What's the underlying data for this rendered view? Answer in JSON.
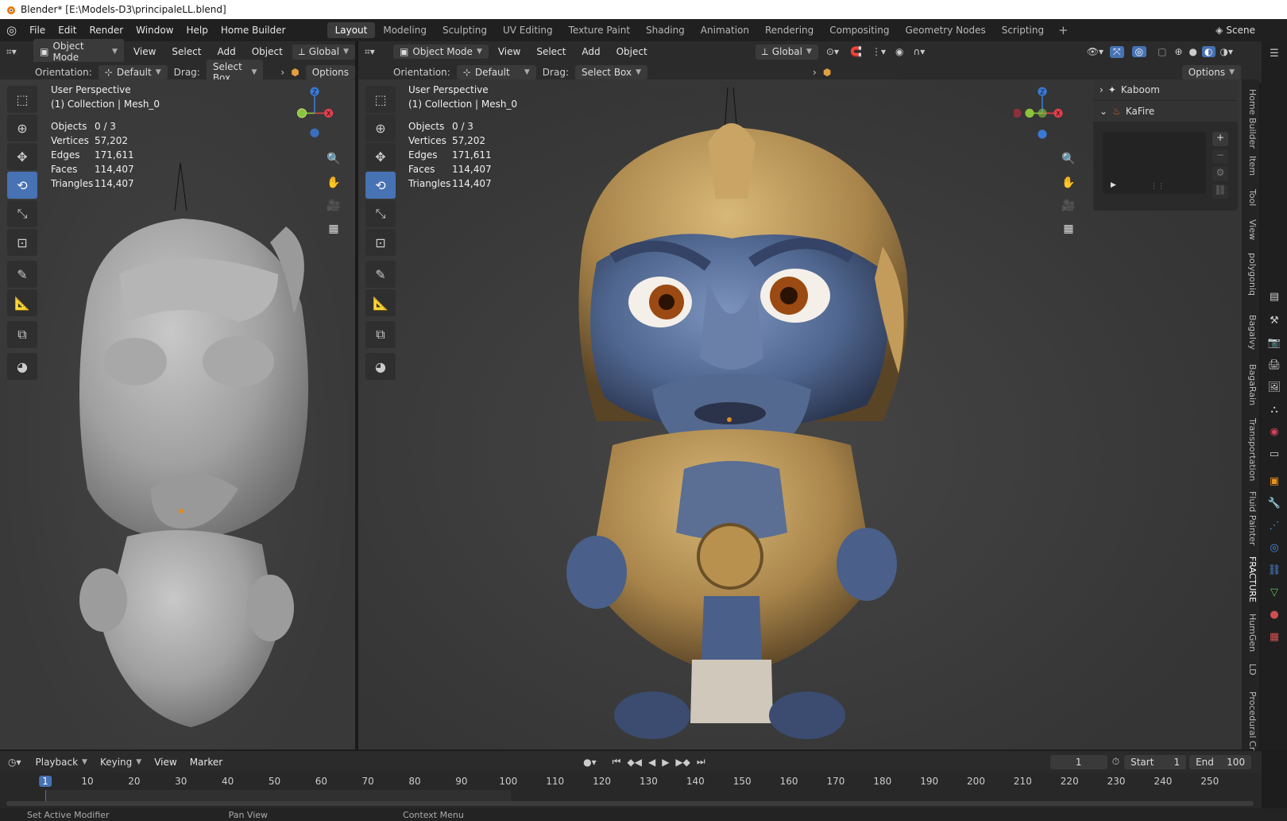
{
  "titlebar": {
    "title": "Blender* [E:\\Models-D3\\principaleLL.blend]"
  },
  "menu": [
    "File",
    "Edit",
    "Render",
    "Window",
    "Help",
    "Home Builder"
  ],
  "workspaces": [
    "Layout",
    "Modeling",
    "Sculpting",
    "UV Editing",
    "Texture Paint",
    "Shading",
    "Animation",
    "Rendering",
    "Compositing",
    "Geometry Nodes",
    "Scripting"
  ],
  "scene": "Scene",
  "left_view": {
    "mode": "Object Mode",
    "menus": [
      "View",
      "Select",
      "Add",
      "Object"
    ],
    "transform": "Global",
    "orientation_label": "Orientation:",
    "orientation_value": "Default",
    "drag_label": "Drag:",
    "drag_value": "Select Box",
    "options": "Options",
    "perspective": "User Perspective",
    "collection": "(1) Collection | Mesh_0"
  },
  "right_view": {
    "mode": "Object Mode",
    "menus": [
      "View",
      "Select",
      "Add",
      "Object"
    ],
    "transform": "Global",
    "orientation_label": "Orientation:",
    "orientation_value": "Default",
    "drag_label": "Drag:",
    "drag_value": "Select Box",
    "options": "Options",
    "perspective": "User Perspective",
    "collection": "(1) Collection | Mesh_0"
  },
  "stats": {
    "objects_label": "Objects",
    "objects": "0 / 3",
    "vertices_label": "Vertices",
    "vertices": "57,202",
    "edges_label": "Edges",
    "edges": "171,611",
    "faces_label": "Faces",
    "faces": "114,407",
    "triangles_label": "Triangles",
    "triangles": "114,407"
  },
  "gizmo": {
    "z": "Z",
    "x": "X",
    "x_color": "#e0404e",
    "y_color": "#8bc43c",
    "z_color": "#3a7ad6"
  },
  "npanel": {
    "items": [
      "Kaboom",
      "KaFire"
    ]
  },
  "side_tabs": [
    "Home Builder",
    "Item",
    "Tool",
    "View",
    "polygoniq",
    "Bagalvy",
    "BagaRain",
    "Transportation",
    "Fluid Painter",
    "FRACTURE",
    "HumGen",
    "LD",
    "Procedural Cr"
  ],
  "timeline": {
    "menus": [
      "Playback",
      "Keying",
      "View",
      "Marker"
    ],
    "current_frame": "1",
    "start_label": "Start",
    "start": "1",
    "end_label": "End",
    "end": "100",
    "ticks": [
      "1",
      "10",
      "20",
      "30",
      "40",
      "50",
      "60",
      "70",
      "80",
      "90",
      "100",
      "110",
      "120",
      "130",
      "140",
      "150",
      "160",
      "170",
      "180",
      "190",
      "200",
      "210",
      "220",
      "230",
      "240",
      "250"
    ]
  },
  "status": {
    "left": "Set Active Modifier",
    "mid": "Pan View",
    "right": "Context Menu"
  },
  "accent": "#4772b3"
}
